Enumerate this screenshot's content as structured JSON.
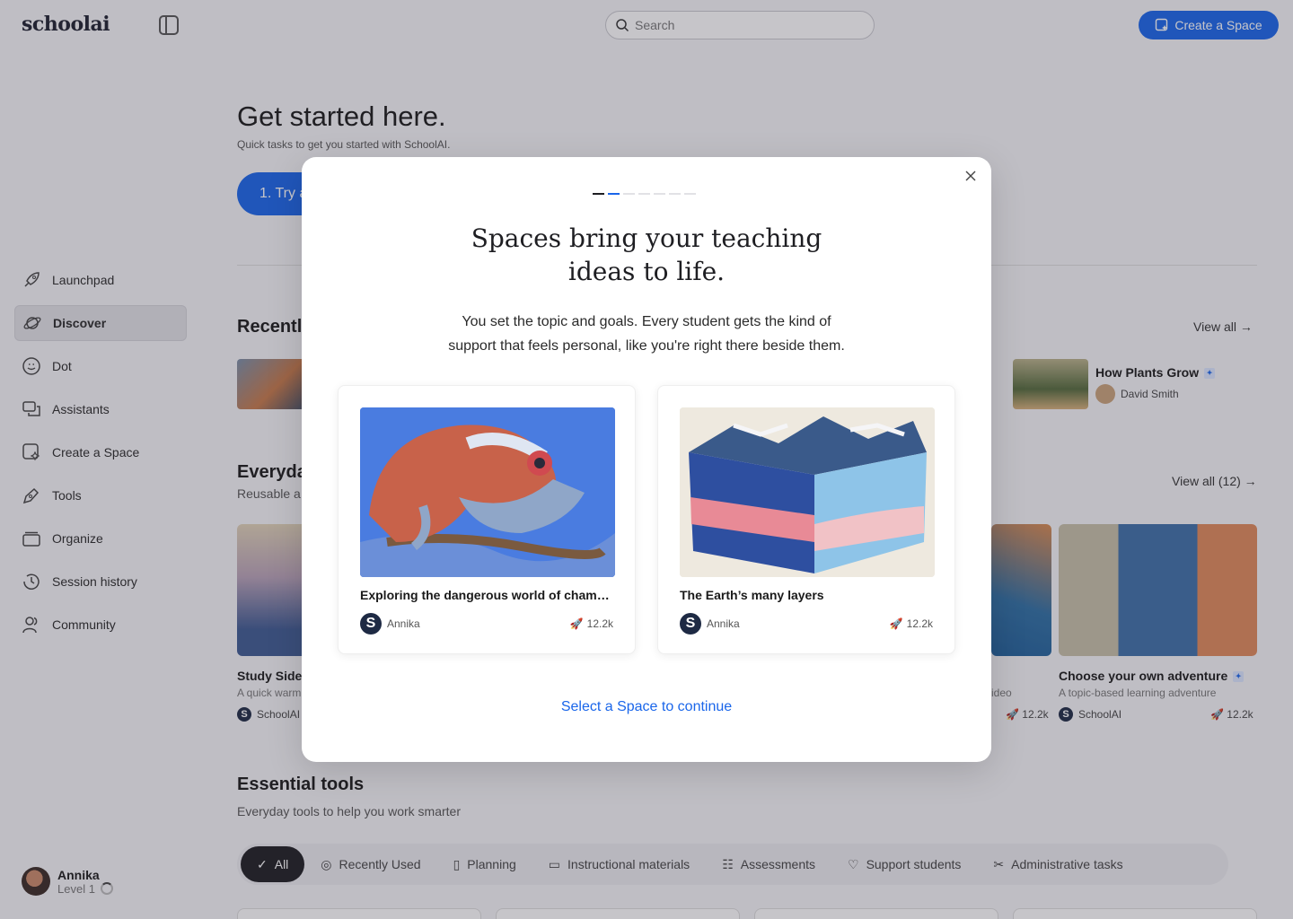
{
  "header": {
    "logo": "schoolai",
    "search_placeholder": "Search",
    "create_label": "Create a Space"
  },
  "sidebar": {
    "items": [
      {
        "label": "Launchpad",
        "icon": "rocket-icon"
      },
      {
        "label": "Discover",
        "icon": "planet-icon"
      },
      {
        "label": "Dot",
        "icon": "smile-icon"
      },
      {
        "label": "Assistants",
        "icon": "chat-icon"
      },
      {
        "label": "Create a Space",
        "icon": "sparkle-icon"
      },
      {
        "label": "Tools",
        "icon": "pen-icon"
      },
      {
        "label": "Organize",
        "icon": "folder-icon"
      },
      {
        "label": "Session history",
        "icon": "clock-icon"
      },
      {
        "label": "Community",
        "icon": "people-icon"
      }
    ],
    "user": {
      "name": "Annika",
      "level": "Level 1"
    }
  },
  "main": {
    "title": "Get started here.",
    "subtitle": "Quick tasks to get you started with SchoolAI.",
    "try_label": "1. Try a",
    "recent_title": "Recentl",
    "view_all": "View all",
    "recent_right": {
      "title": "How Plants Grow",
      "author": "David Smith"
    },
    "everyday_title": "Everyda",
    "everyday_sub": "Reusable a",
    "view_all_count": "View all (12)",
    "cards": [
      {
        "title": "Study Side",
        "sub": "A quick warm",
        "author": "SchoolAI"
      },
      {
        "title": "",
        "sub": "ideo",
        "author": "",
        "count": "12.2k"
      },
      {
        "title": "Choose your own adventure",
        "sub": "A topic-based learning adventure",
        "author": "SchoolAI",
        "count": "12.2k"
      }
    ],
    "essential_title": "Essential tools",
    "essential_sub": "Everyday tools to help you work smarter",
    "chips": [
      {
        "label": "All"
      },
      {
        "label": "Recently Used"
      },
      {
        "label": "Planning"
      },
      {
        "label": "Instructional materials"
      },
      {
        "label": "Assessments"
      },
      {
        "label": "Support students"
      },
      {
        "label": "Administrative tasks"
      }
    ]
  },
  "modal": {
    "step": 2,
    "total_steps": 7,
    "title_line1": "Spaces bring your teaching",
    "title_line2": "ideas to life.",
    "body_line1": "You set the topic and goals. Every student gets the kind of",
    "body_line2": "support that feels personal, like you're right there beside them.",
    "cards": [
      {
        "title": "Exploring the dangerous world of chamel...",
        "author": "Annika",
        "count": "12.2k"
      },
      {
        "title": "The Earth’s many layers",
        "author": "Annika",
        "count": "12.2k"
      }
    ],
    "continue_label": "Select a Space to continue"
  },
  "colors": {
    "accent": "#1a66ea",
    "dark": "#1e1e22"
  }
}
